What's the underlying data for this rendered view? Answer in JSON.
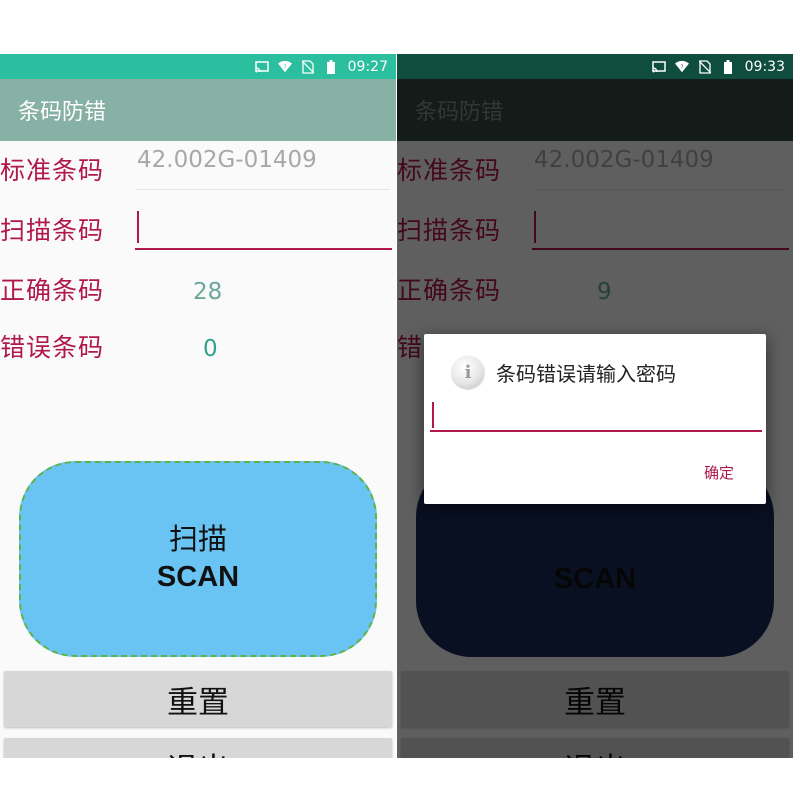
{
  "screens": [
    {
      "status_time": "09:27",
      "app_title": "条码防错",
      "labels": {
        "standard": "标准条码",
        "scan": "扫描条码",
        "correct": "正确条码",
        "error": "错误条码"
      },
      "standard_value": "42.002G-01409",
      "scan_value": "",
      "correct_count": "28",
      "error_count": "0",
      "scan_button": {
        "cn": "扫描",
        "en": "SCAN"
      },
      "reset_label": "重置",
      "exit_label": "退出"
    },
    {
      "status_time": "09:33",
      "app_title": "条码防错",
      "labels": {
        "standard": "标准条码",
        "scan": "扫描条码",
        "correct": "正确条码",
        "error": "错"
      },
      "standard_value": "42.002G-01409",
      "scan_value": "",
      "correct_count": "9",
      "scan_button": {
        "en": "SCAN"
      },
      "reset_label": "重置",
      "exit_label": "退出",
      "dialog": {
        "title": "条码错误请输入密码",
        "password_value": "",
        "ok_label": "确定",
        "icon": "info-icon"
      }
    }
  ],
  "status_icons": [
    "cast-icon",
    "wifi-icon",
    "no-sim-icon",
    "battery-icon"
  ],
  "colors": {
    "label_accent": "#b0174d",
    "left_statusbar": "#2bbf9f",
    "left_appbar": "#88b1a6",
    "scan_button": "#6ac4f3",
    "dialog_overlay": "rgba(0,0,0,0.62)"
  }
}
